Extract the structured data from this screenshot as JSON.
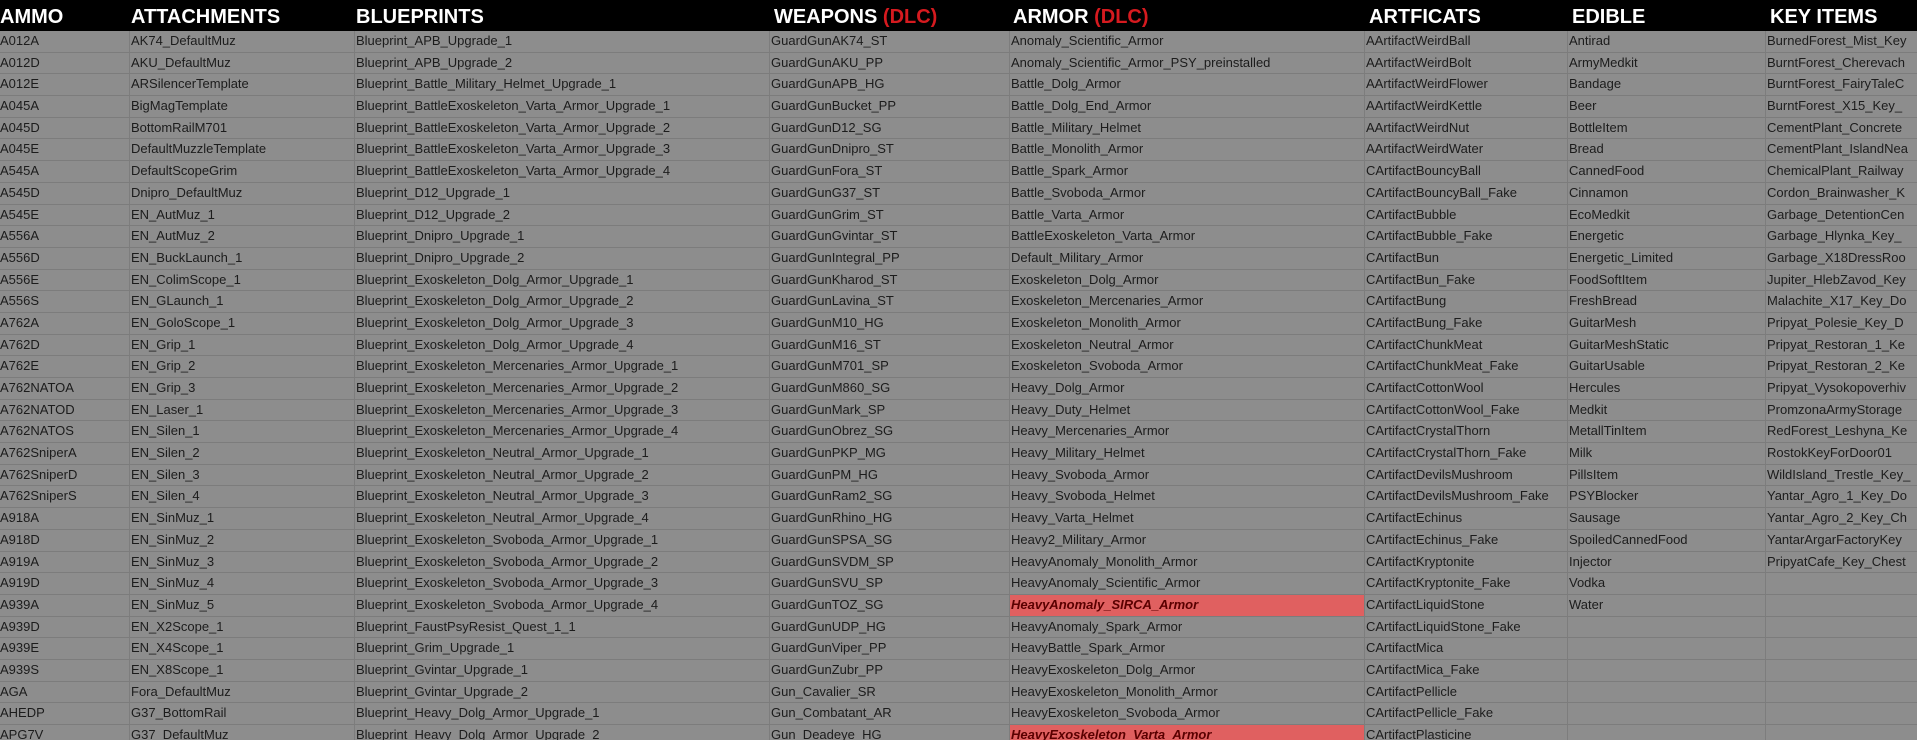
{
  "headers": [
    {
      "label": "AMMO",
      "suffix": ""
    },
    {
      "label": "ATTACHMENTS",
      "suffix": ""
    },
    {
      "label": "BLUEPRINTS",
      "suffix": ""
    },
    {
      "label": "WEAPONS ",
      "suffix": "(DLC)"
    },
    {
      "label": "ARMOR ",
      "suffix": "(DLC)"
    },
    {
      "label": "ARTFICATS",
      "suffix": ""
    },
    {
      "label": "EDIBLE",
      "suffix": ""
    },
    {
      "label": "KEY ITEMS",
      "suffix": ""
    }
  ],
  "colors": {
    "header_bg": "#000000",
    "header_text": "#ffffff",
    "dlc_tag": "#d61a1f",
    "cell_bg": "#8d8d8d",
    "highlight_bg": "#e06060",
    "highlight_text": "#5a0000"
  },
  "highlighted": [
    {
      "row": 28,
      "col": 4
    },
    {
      "row": 35,
      "col": 4
    }
  ],
  "columns": {
    "ammo": [
      "A012A",
      "A012D",
      "A012E",
      "A045A",
      "A045D",
      "A045E",
      "A545A",
      "A545D",
      "A545E",
      "A556A",
      "A556D",
      "A556E",
      "A556S",
      "A762A",
      "A762D",
      "A762E",
      "A762NATOA",
      "A762NATOD",
      "A762NATOS",
      "A762SniperA",
      "A762SniperD",
      "A762SniperS",
      "A918A",
      "A918D",
      "A919A",
      "A919D",
      "A939A",
      "A939D",
      "A939E",
      "A939S",
      "AGA",
      "AHEDP",
      "APG7V"
    ],
    "attachments": [
      "AK74_DefaultMuz",
      "AKU_DefaultMuz",
      "ARSilencerTemplate",
      "BigMagTemplate",
      "BottomRailM701",
      "DefaultMuzzleTemplate",
      "DefaultScopeGrim",
      "Dnipro_DefaultMuz",
      "EN_AutMuz_1",
      "EN_AutMuz_2",
      "EN_BuckLaunch_1",
      "EN_ColimScope_1",
      "EN_GLaunch_1",
      "EN_GoloScope_1",
      "EN_Grip_1",
      "EN_Grip_2",
      "EN_Grip_3",
      "EN_Laser_1",
      "EN_Silen_1",
      "EN_Silen_2",
      "EN_Silen_3",
      "EN_Silen_4",
      "EN_SinMuz_1",
      "EN_SinMuz_2",
      "EN_SinMuz_3",
      "EN_SinMuz_4",
      "EN_SinMuz_5",
      "EN_X2Scope_1",
      "EN_X4Scope_1",
      "EN_X8Scope_1",
      "Fora_DefaultMuz",
      "G37_BottomRail",
      "G37_DefaultMuz"
    ],
    "blueprints": [
      "Blueprint_APB_Upgrade_1",
      "Blueprint_APB_Upgrade_2",
      "Blueprint_Battle_Military_Helmet_Upgrade_1",
      "Blueprint_BattleExoskeleton_Varta_Armor_Upgrade_1",
      "Blueprint_BattleExoskeleton_Varta_Armor_Upgrade_2",
      "Blueprint_BattleExoskeleton_Varta_Armor_Upgrade_3",
      "Blueprint_BattleExoskeleton_Varta_Armor_Upgrade_4",
      "Blueprint_D12_Upgrade_1",
      "Blueprint_D12_Upgrade_2",
      "Blueprint_Dnipro_Upgrade_1",
      "Blueprint_Dnipro_Upgrade_2",
      "Blueprint_Exoskeleton_Dolg_Armor_Upgrade_1",
      "Blueprint_Exoskeleton_Dolg_Armor_Upgrade_2",
      "Blueprint_Exoskeleton_Dolg_Armor_Upgrade_3",
      "Blueprint_Exoskeleton_Dolg_Armor_Upgrade_4",
      "Blueprint_Exoskeleton_Mercenaries_Armor_Upgrade_1",
      "Blueprint_Exoskeleton_Mercenaries_Armor_Upgrade_2",
      "Blueprint_Exoskeleton_Mercenaries_Armor_Upgrade_3",
      "Blueprint_Exoskeleton_Mercenaries_Armor_Upgrade_4",
      "Blueprint_Exoskeleton_Neutral_Armor_Upgrade_1",
      "Blueprint_Exoskeleton_Neutral_Armor_Upgrade_2",
      "Blueprint_Exoskeleton_Neutral_Armor_Upgrade_3",
      "Blueprint_Exoskeleton_Neutral_Armor_Upgrade_4",
      "Blueprint_Exoskeleton_Svoboda_Armor_Upgrade_1",
      "Blueprint_Exoskeleton_Svoboda_Armor_Upgrade_2",
      "Blueprint_Exoskeleton_Svoboda_Armor_Upgrade_3",
      "Blueprint_Exoskeleton_Svoboda_Armor_Upgrade_4",
      "Blueprint_FaustPsyResist_Quest_1_1",
      "Blueprint_Grim_Upgrade_1",
      "Blueprint_Gvintar_Upgrade_1",
      "Blueprint_Gvintar_Upgrade_2",
      "Blueprint_Heavy_Dolg_Armor_Upgrade_1",
      "Blueprint_Heavy_Dolg_Armor_Upgrade_2"
    ],
    "weapons": [
      "GuardGunAK74_ST",
      "GuardGunAKU_PP",
      "GuardGunAPB_HG",
      "GuardGunBucket_PP",
      "GuardGunD12_SG",
      "GuardGunDnipro_ST",
      "GuardGunFora_ST",
      "GuardGunG37_ST",
      "GuardGunGrim_ST",
      "GuardGunGvintar_ST",
      "GuardGunIntegral_PP",
      "GuardGunKharod_ST",
      "GuardGunLavina_ST",
      "GuardGunM10_HG",
      "GuardGunM16_ST",
      "GuardGunM701_SP",
      "GuardGunM860_SG",
      "GuardGunMark_SP",
      "GuardGunObrez_SG",
      "GuardGunPKP_MG",
      "GuardGunPM_HG",
      "GuardGunRam2_SG",
      "GuardGunRhino_HG",
      "GuardGunSPSA_SG",
      "GuardGunSVDM_SP",
      "GuardGunSVU_SP",
      "GuardGunTOZ_SG",
      "GuardGunUDP_HG",
      "GuardGunViper_PP",
      "GuardGunZubr_PP",
      "Gun_Cavalier_SR",
      "Gun_Combatant_AR",
      "Gun_Deadeye_HG"
    ],
    "armor": [
      "Anomaly_Scientific_Armor",
      "Anomaly_Scientific_Armor_PSY_preinstalled",
      "Battle_Dolg_Armor",
      "Battle_Dolg_End_Armor",
      "Battle_Military_Helmet",
      "Battle_Monolith_Armor",
      "Battle_Spark_Armor",
      "Battle_Svoboda_Armor",
      "Battle_Varta_Armor",
      "BattleExoskeleton_Varta_Armor",
      "Default_Military_Armor",
      "Exoskeleton_Dolg_Armor",
      "Exoskeleton_Mercenaries_Armor",
      "Exoskeleton_Monolith_Armor",
      "Exoskeleton_Neutral_Armor",
      "Exoskeleton_Svoboda_Armor",
      "Heavy_Dolg_Armor",
      "Heavy_Duty_Helmet",
      "Heavy_Mercenaries_Armor",
      "Heavy_Military_Helmet",
      "Heavy_Svoboda_Armor",
      "Heavy_Svoboda_Helmet",
      "Heavy_Varta_Helmet",
      "Heavy2_Military_Armor",
      "HeavyAnomaly_Monolith_Armor",
      "HeavyAnomaly_Scientific_Armor",
      "HeavyAnomaly_SIRCA_Armor",
      "HeavyAnomaly_Spark_Armor",
      "HeavyBattle_Spark_Armor",
      "HeavyExoskeleton_Dolg_Armor",
      "HeavyExoskeleton_Monolith_Armor",
      "HeavyExoskeleton_Svoboda_Armor",
      "HeavyExoskeleton_Varta_Armor"
    ],
    "artifacts": [
      "AArtifactWeirdBall",
      "AArtifactWeirdBolt",
      "AArtifactWeirdFlower",
      "AArtifactWeirdKettle",
      "AArtifactWeirdNut",
      "AArtifactWeirdWater",
      "CArtifactBouncyBall",
      "CArtifactBouncyBall_Fake",
      "CArtifactBubble",
      "CArtifactBubble_Fake",
      "CArtifactBun",
      "CArtifactBun_Fake",
      "CArtifactBung",
      "CArtifactBung_Fake",
      "CArtifactChunkMeat",
      "CArtifactChunkMeat_Fake",
      "CArtifactCottonWool",
      "CArtifactCottonWool_Fake",
      "CArtifactCrystalThorn",
      "CArtifactCrystalThorn_Fake",
      "CArtifactDevilsMushroom",
      "CArtifactDevilsMushroom_Fake",
      "CArtifactEchinus",
      "CArtifactEchinus_Fake",
      "CArtifactKryptonite",
      "CArtifactKryptonite_Fake",
      "CArtifactLiquidStone",
      "CArtifactLiquidStone_Fake",
      "CArtifactMica",
      "CArtifactMica_Fake",
      "CArtifactPellicle",
      "CArtifactPellicle_Fake",
      "CArtifactPlasticine"
    ],
    "edible": [
      "Antirad",
      "ArmyMedkit",
      "Bandage",
      "Beer",
      "BottleItem",
      "Bread",
      "CannedFood",
      "Cinnamon",
      "EcoMedkit",
      "Energetic",
      "Energetic_Limited",
      "FoodSoftItem",
      "FreshBread",
      "GuitarMesh",
      "GuitarMeshStatic",
      "GuitarUsable",
      "Hercules",
      "Medkit",
      "MetallTinItem",
      "Milk",
      "PillsItem",
      "PSYBlocker",
      "Sausage",
      "SpoiledCannedFood",
      "Injector",
      "Vodka",
      "Water",
      "",
      "",
      "",
      "",
      "",
      ""
    ],
    "key_items": [
      "BurnedForest_Mist_Key",
      "BurntForest_Cherevach",
      "BurntForest_FairyTaleC",
      "BurntForest_X15_Key_",
      "CementPlant_Concrete",
      "CementPlant_IslandNea",
      "ChemicalPlant_Railway",
      "Cordon_Brainwasher_K",
      "Garbage_DetentionCen",
      "Garbage_Hlynka_Key_",
      "Garbage_X18DressRoo",
      "Jupiter_HlebZavod_Key",
      "Malachite_X17_Key_Do",
      "Pripyat_Polesie_Key_D",
      "Pripyat_Restoran_1_Ke",
      "Pripyat_Restoran_2_Ke",
      "Pripyat_Vysokopoverhiv",
      "PromzonaArmyStorage",
      "RedForest_Leshyna_Ke",
      "RostokKeyForDoor01",
      "WildIsland_Trestle_Key_",
      "Yantar_Agro_1_Key_Do",
      "Yantar_Agro_2_Key_Ch",
      "YantarArgarFactoryKey",
      "PripyatCafe_Key_Chest",
      "",
      "",
      "",
      "",
      "",
      "",
      "",
      ""
    ]
  }
}
